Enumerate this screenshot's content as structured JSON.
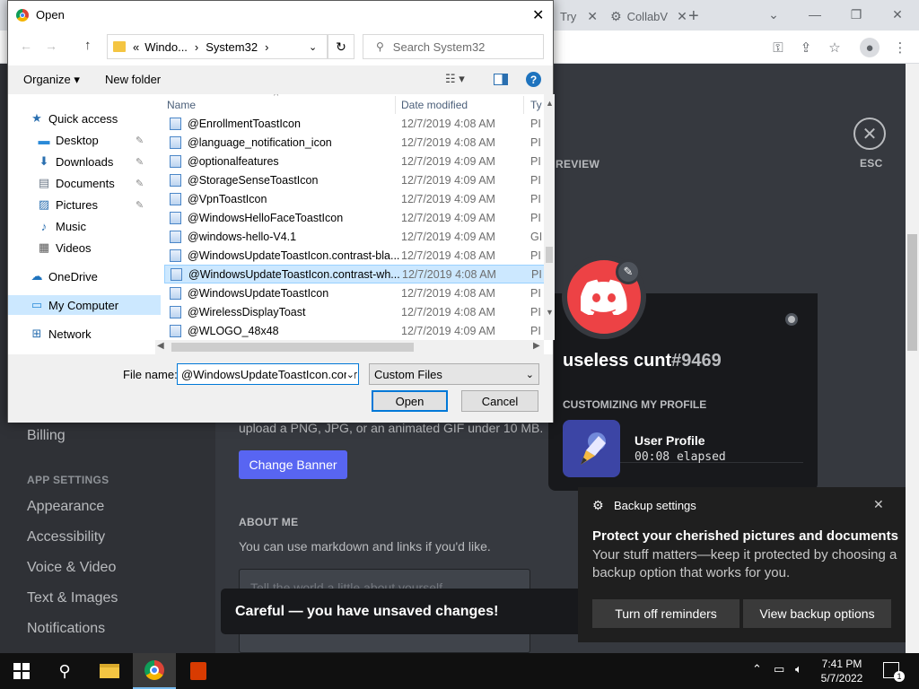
{
  "browser": {
    "tabs": [
      {
        "label": "Try"
      },
      {
        "label": "CollabV"
      }
    ],
    "new_tab": "+"
  },
  "discord": {
    "sidebar": {
      "billing": "Billing",
      "app_settings_header": "APP SETTINGS",
      "items": [
        "Appearance",
        "Accessibility",
        "Voice & Video",
        "Text & Images",
        "Notifications"
      ]
    },
    "preview_label": "REVIEW",
    "esc_label": "ESC",
    "banner_hint": "upload a PNG, JPG, or an animated GIF under 10 MB.",
    "change_banner": "Change Banner",
    "about_me_header": "ABOUT ME",
    "about_me_hint": "You can use markdown and links if you'd like.",
    "about_me_placeholder": "Tell the world a little about yourself",
    "username": "useless cunt",
    "discriminator": "#9469",
    "customizing_header": "CUSTOMIZING MY PROFILE",
    "activity_title": "User Profile",
    "activity_elapsed": "00:08 elapsed",
    "unsaved_text": "Careful — you have unsaved changes!",
    "accent": "#ed4245",
    "blurple": "#5865f2"
  },
  "toast": {
    "app": "Backup settings",
    "title": "Protect your cherished pictures and documents",
    "body": "Your stuff matters—keep it protected by choosing a backup option that works for you.",
    "btn_off": "Turn off reminders",
    "btn_view": "View backup options"
  },
  "dialog": {
    "title": "Open",
    "path": [
      "«",
      "Windo...",
      "›",
      "System32",
      "›"
    ],
    "search_placeholder": "Search System32",
    "organize": "Organize",
    "new_folder": "New folder",
    "nav": [
      {
        "label": "Quick access",
        "icon": "star-icon",
        "indent": 0
      },
      {
        "label": "Desktop",
        "icon": "desktop-icon",
        "indent": 1,
        "pinned": true
      },
      {
        "label": "Downloads",
        "icon": "download-icon",
        "indent": 1,
        "pinned": true
      },
      {
        "label": "Documents",
        "icon": "document-icon",
        "indent": 1,
        "pinned": true
      },
      {
        "label": "Pictures",
        "icon": "pictures-icon",
        "indent": 1,
        "pinned": true
      },
      {
        "label": "Music",
        "icon": "music-icon",
        "indent": 1
      },
      {
        "label": "Videos",
        "icon": "video-icon",
        "indent": 1
      },
      {
        "label": "OneDrive",
        "icon": "cloud-icon",
        "indent": 0
      },
      {
        "label": "My Computer",
        "icon": "computer-icon",
        "indent": 0,
        "selected": true
      },
      {
        "label": "Network",
        "icon": "network-icon",
        "indent": 0
      }
    ],
    "columns": {
      "name": "Name",
      "date": "Date modified",
      "type": "Ty"
    },
    "files": [
      {
        "name": "@EnrollmentToastIcon",
        "date": "12/7/2019 4:08 AM",
        "type": "PI"
      },
      {
        "name": "@language_notification_icon",
        "date": "12/7/2019 4:08 AM",
        "type": "PI"
      },
      {
        "name": "@optionalfeatures",
        "date": "12/7/2019 4:09 AM",
        "type": "PI"
      },
      {
        "name": "@StorageSenseToastIcon",
        "date": "12/7/2019 4:09 AM",
        "type": "PI"
      },
      {
        "name": "@VpnToastIcon",
        "date": "12/7/2019 4:09 AM",
        "type": "PI"
      },
      {
        "name": "@WindowsHelloFaceToastIcon",
        "date": "12/7/2019 4:09 AM",
        "type": "PI"
      },
      {
        "name": "@windows-hello-V4.1",
        "date": "12/7/2019 4:09 AM",
        "type": "GI"
      },
      {
        "name": "@WindowsUpdateToastIcon.contrast-bla...",
        "date": "12/7/2019 4:08 AM",
        "type": "PI"
      },
      {
        "name": "@WindowsUpdateToastIcon.contrast-wh...",
        "date": "12/7/2019 4:08 AM",
        "type": "PI",
        "selected": true
      },
      {
        "name": "@WindowsUpdateToastIcon",
        "date": "12/7/2019 4:08 AM",
        "type": "PI"
      },
      {
        "name": "@WirelessDisplayToast",
        "date": "12/7/2019 4:08 AM",
        "type": "PI"
      },
      {
        "name": "@WLOGO_48x48",
        "date": "12/7/2019 4:09 AM",
        "type": "PI"
      }
    ],
    "file_name_label": "File name:",
    "file_name_value": "@WindowsUpdateToastIcon.contr",
    "file_type": "Custom Files",
    "open": "Open",
    "cancel": "Cancel"
  },
  "taskbar": {
    "time": "7:41 PM",
    "date": "5/7/2022",
    "notif_count": "1"
  }
}
